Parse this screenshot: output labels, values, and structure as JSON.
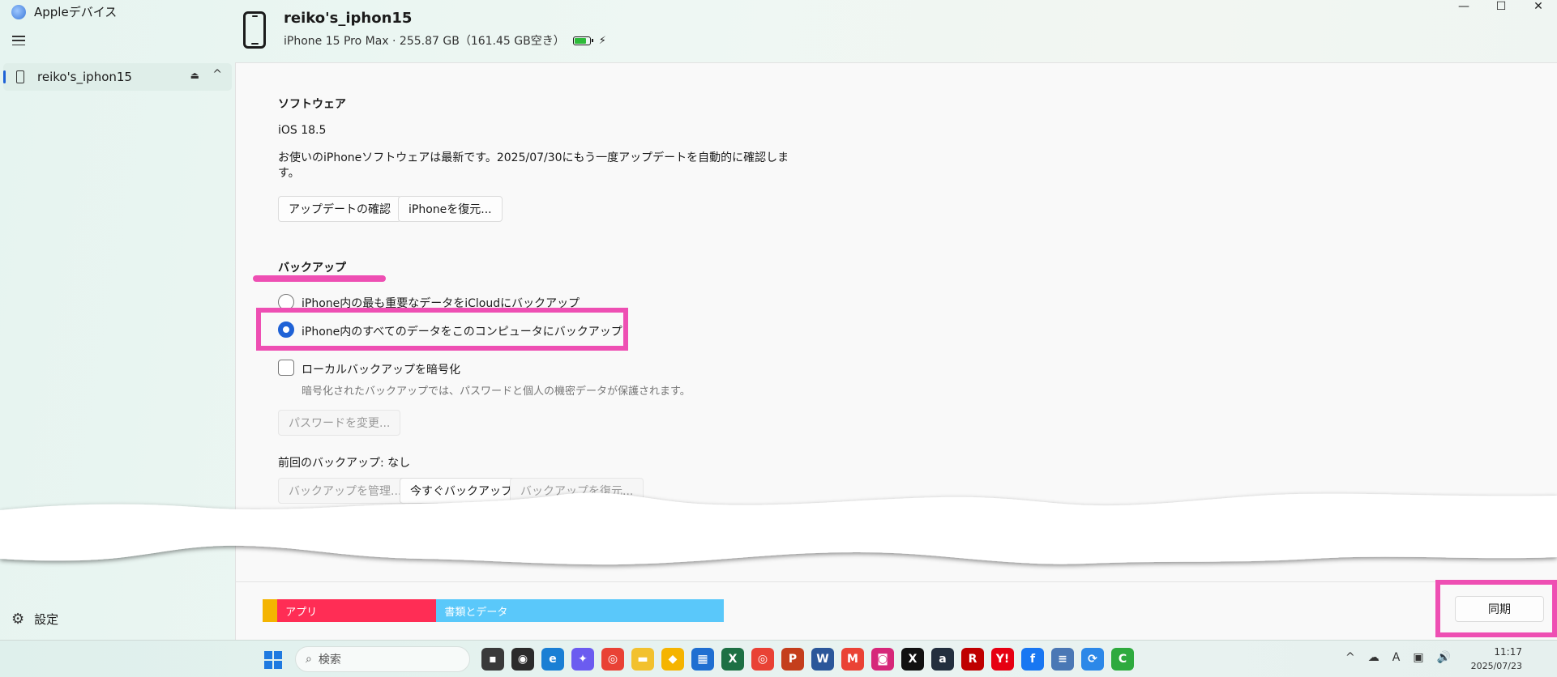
{
  "app": {
    "title": "Appleデバイス",
    "window_controls": {
      "minimize": "—",
      "maximize": "☐",
      "close": "✕"
    }
  },
  "device": {
    "name": "reiko's_iphon15",
    "info": "iPhone 15 Pro Max · 255.87 GB（161.45 GB空き）",
    "battery_level": 0.8,
    "charging": true
  },
  "sidebar": {
    "items": [
      {
        "label": "reiko's_iphon15",
        "selected": true
      }
    ],
    "settings_label": "設定"
  },
  "software": {
    "title": "ソフトウェア",
    "version": "iOS 18.5",
    "status_line1": "お使いのiPhoneソフトウェアは最新です。2025/07/30にもう一度アップデートを自動的に確認しま",
    "status_line2": "す。",
    "check_update_label": "アップデートの確認",
    "restore_label": "iPhoneを復元..."
  },
  "backup": {
    "title": "バックアップ",
    "option_icloud": "iPhone内の最も重要なデータをiCloudにバックアップ",
    "option_computer": "iPhone内のすべてのデータをこのコンピュータにバックアップ",
    "selected_option": "computer",
    "encrypt_label": "ローカルバックアップを暗号化",
    "encrypt_checked": false,
    "encrypt_note": "暗号化されたバックアップでは、パスワードと個人の機密データが保護されます。",
    "change_password_label": "パスワードを変更...",
    "last_backup": "前回のバックアップ: なし",
    "manage_label": "バックアップを管理...",
    "backup_now_label": "今すぐバックアップ",
    "restore_backup_label": "バックアップを復元..."
  },
  "storage": {
    "segments": [
      {
        "label": "",
        "color": "#f4b400",
        "fraction": 0.012
      },
      {
        "label": "アプリ",
        "color": "#ff2d55",
        "fraction": 0.13
      },
      {
        "label": "書類とデータ",
        "color": "#5ac8fa",
        "fraction": 0.235
      }
    ],
    "sync_label": "同期"
  },
  "taskbar": {
    "search_placeholder": "検索",
    "apps": [
      "Files",
      "Game",
      "Edge",
      "Copilot",
      "Chrome",
      "Explorer",
      "Keep",
      "Store",
      "Excel",
      "Chrome Profile",
      "PowerPoint",
      "Word",
      "Gmail",
      "Instagram",
      "X",
      "Amazon",
      "Rakuten",
      "Yahoo",
      "Facebook",
      "Notepad",
      "Apple Devices",
      "Camtasia"
    ],
    "app_glyphs": [
      "▪",
      "◉",
      "e",
      "✦",
      "◎",
      "▬",
      "◆",
      "▦",
      "X",
      "◎",
      "P",
      "W",
      "M",
      "◙",
      "X",
      "a",
      "R",
      "Y!",
      "f",
      "≡",
      "⟳",
      "C"
    ],
    "app_colors": [
      "#3a3a3a",
      "#2b2b2b",
      "#1a7fd4",
      "#6b5cf0",
      "#e94235",
      "#f2c12e",
      "#f5b400",
      "#1f6fd1",
      "#1d7044",
      "#e94235",
      "#c43e1c",
      "#2b579a",
      "#ea4335",
      "#d6287a",
      "#111111",
      "#232f3e",
      "#bf0000",
      "#e60012",
      "#1877f2",
      "#4a78b5",
      "#2c88e8",
      "#2eaa3e"
    ],
    "tray": [
      "^",
      "☁",
      "A",
      "▣",
      "🔊"
    ],
    "time": "11:17",
    "date": "2025/07/23"
  }
}
